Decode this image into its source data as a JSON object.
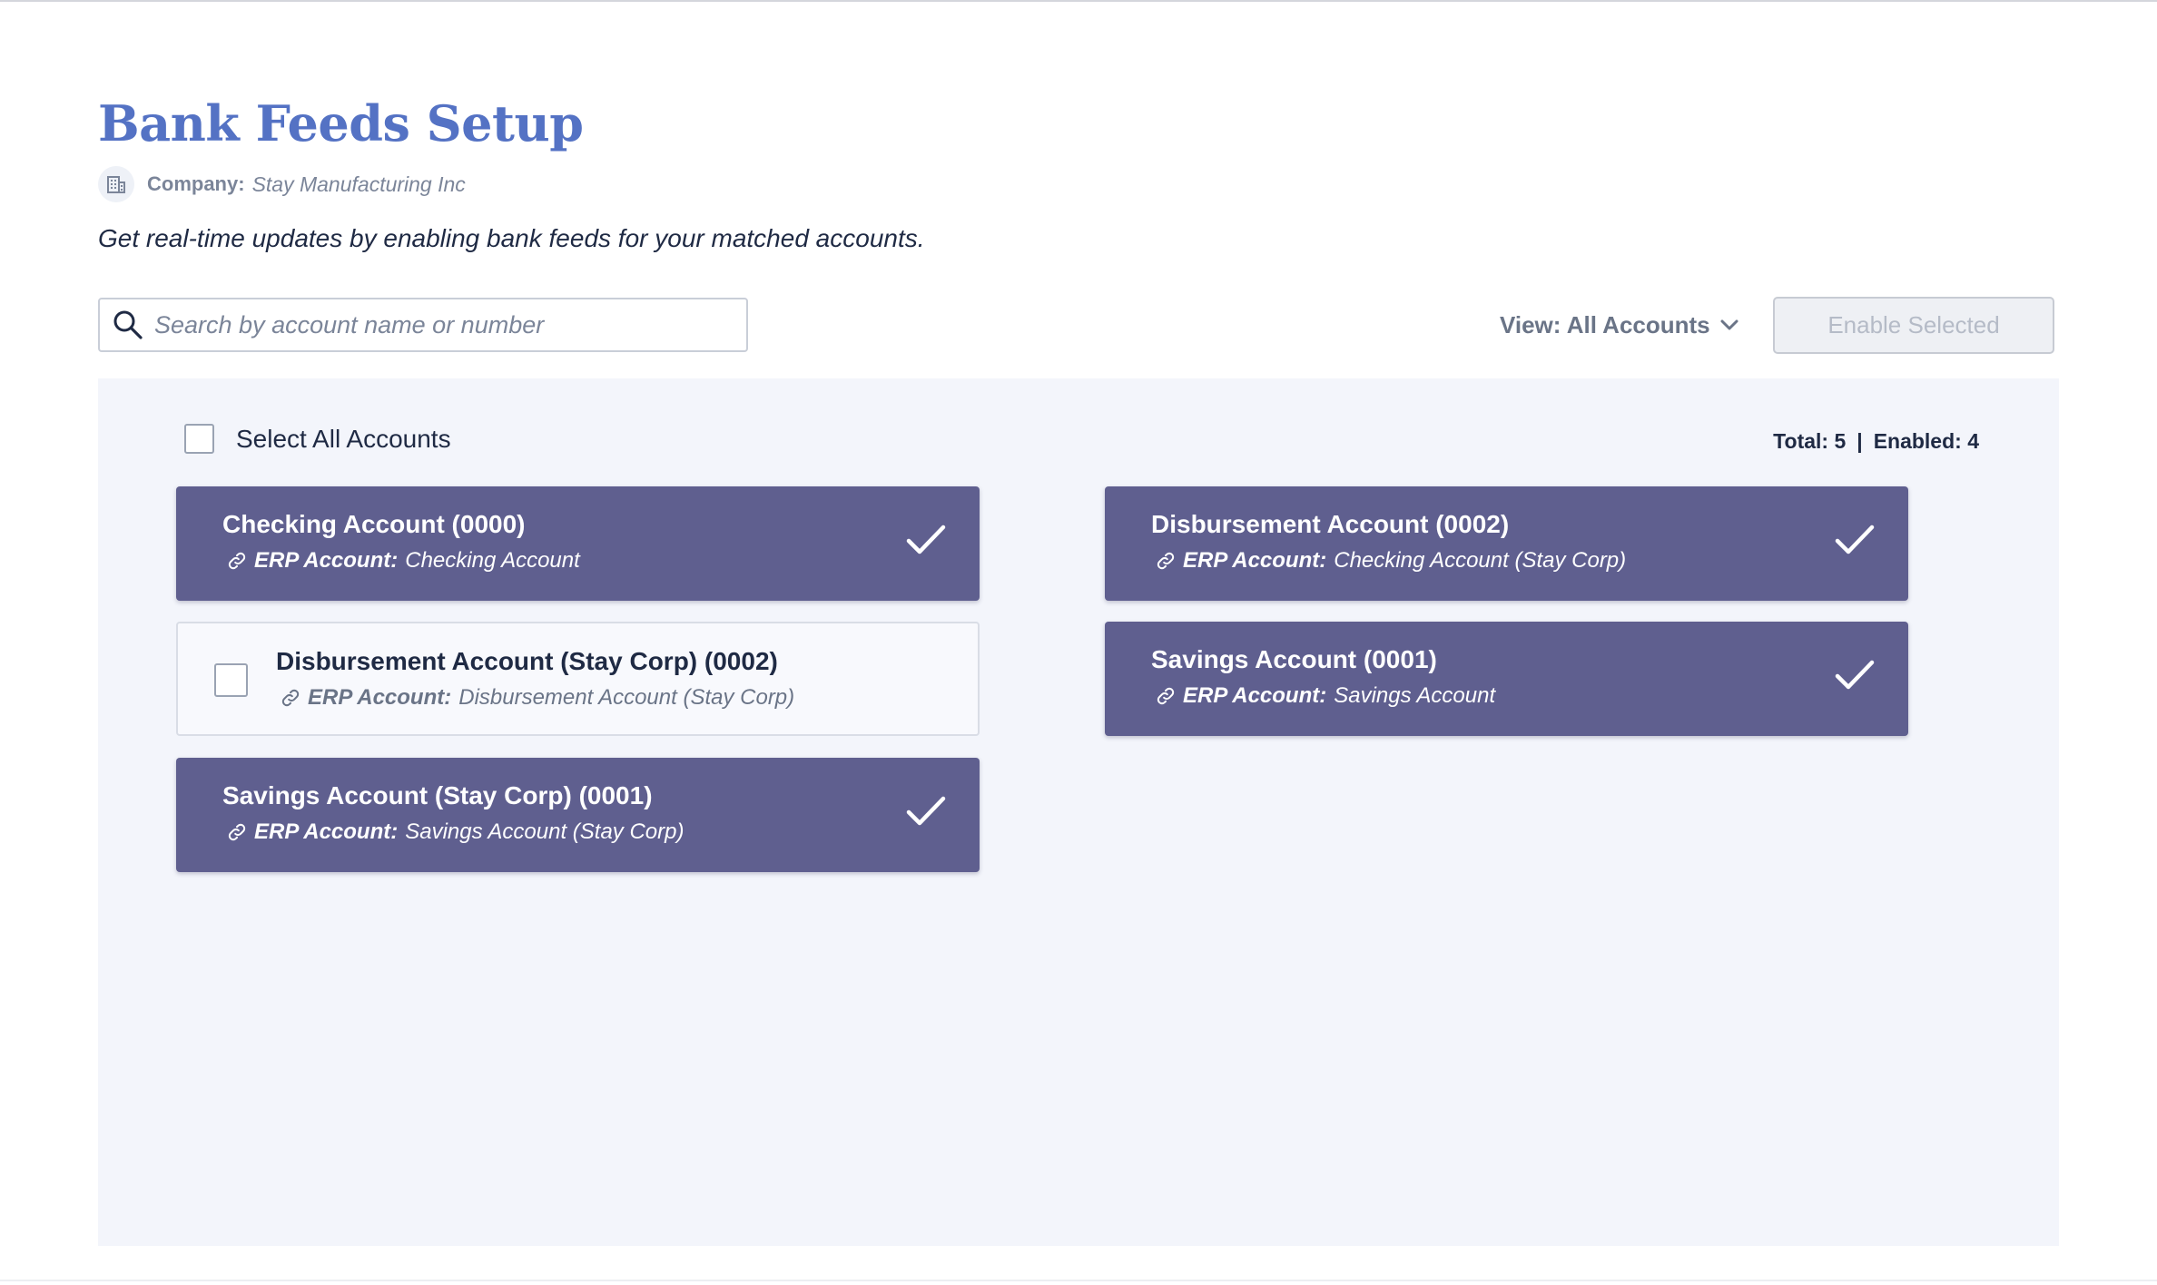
{
  "header": {
    "title": "Bank Feeds Setup",
    "company_label": "Company:",
    "company_name": "Stay Manufacturing Inc",
    "subtitle": "Get real-time updates by enabling bank feeds for your matched accounts."
  },
  "toolbar": {
    "search_placeholder": "Search by account name or number",
    "search_value": "",
    "view_label": "View: All Accounts",
    "enable_button_label": "Enable Selected"
  },
  "panel": {
    "select_all_label": "Select All Accounts",
    "total_text": "Total: 5",
    "separator": "|",
    "enabled_text": "Enabled: 4"
  },
  "erp_label": "ERP Account:",
  "accounts": [
    {
      "name": "Checking Account (0000)",
      "erp_account": "Checking Account",
      "enabled": true
    },
    {
      "name": "Disbursement Account (0002)",
      "erp_account": "Checking Account (Stay Corp)",
      "enabled": true
    },
    {
      "name": "Disbursement Account (Stay Corp) (0002)",
      "erp_account": "Disbursement Account (Stay Corp)",
      "enabled": false
    },
    {
      "name": "Savings Account (0001)",
      "erp_account": "Savings Account",
      "enabled": true
    },
    {
      "name": "Savings Account (Stay Corp) (0001)",
      "erp_account": "Savings Account (Stay Corp)",
      "enabled": true
    }
  ],
  "colors": {
    "title": "#5472c4",
    "card_enabled": "#5f5f8f",
    "panel_bg": "#f3f5fb"
  },
  "icons": {
    "company": "building-icon",
    "search": "search-icon",
    "dropdown": "chevron-down-icon",
    "erp_link": "link-icon",
    "enabled_check": "checkmark-icon"
  }
}
